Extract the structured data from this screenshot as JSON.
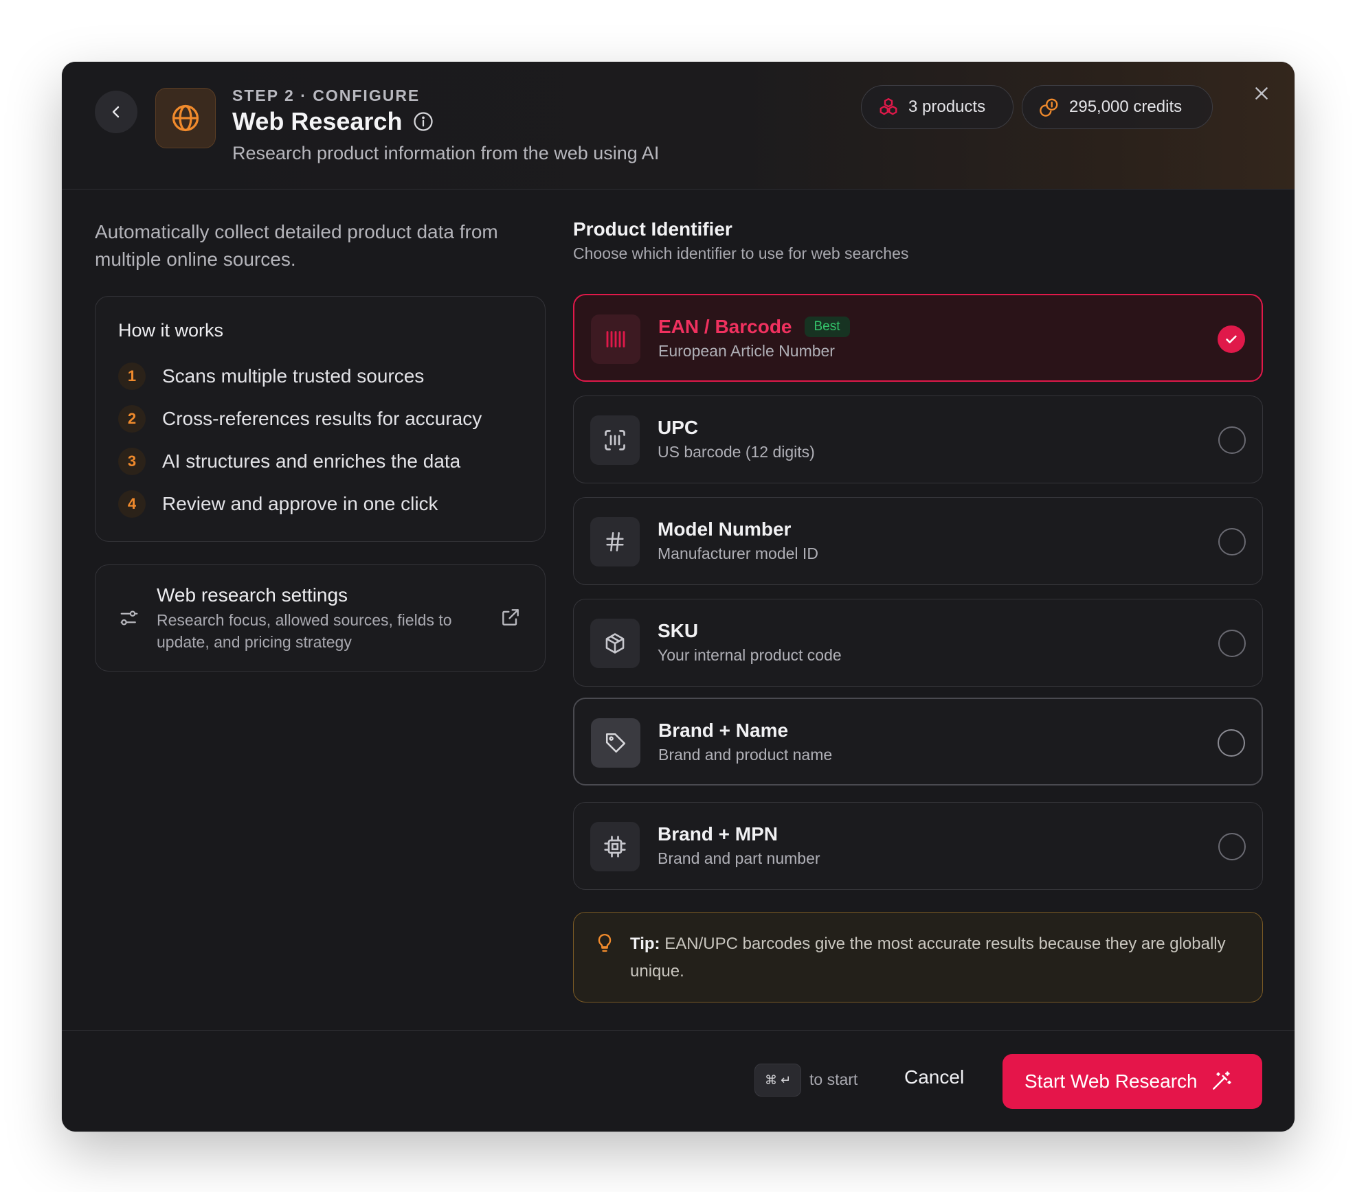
{
  "header": {
    "step": "STEP 2 · CONFIGURE",
    "title": "Web Research",
    "subtitle": "Research product information from the web using AI",
    "products_pill": "3 products",
    "credits_pill": "295,000 credits"
  },
  "left": {
    "intro": "Automatically collect detailed product data from multiple online sources.",
    "how_it_works": {
      "title": "How it works",
      "steps": [
        {
          "num": "1",
          "text": "Scans multiple trusted sources"
        },
        {
          "num": "2",
          "text": "Cross-references results for accuracy"
        },
        {
          "num": "3",
          "text": "AI structures and enriches the data"
        },
        {
          "num": "4",
          "text": "Review and approve in one click"
        }
      ]
    },
    "settings": {
      "title": "Web research settings",
      "description": "Research focus, allowed sources, fields to update, and pricing strategy"
    }
  },
  "identifier": {
    "title": "Product Identifier",
    "subtitle": "Choose which identifier to use for web searches",
    "options": [
      {
        "title": "EAN / Barcode",
        "badge": "Best",
        "subtitle": "European Article Number",
        "icon": "barcode-icon",
        "selected": true
      },
      {
        "title": "UPC",
        "subtitle": "US barcode (12 digits)",
        "icon": "scan-barcode-icon",
        "selected": false
      },
      {
        "title": "Model Number",
        "subtitle": "Manufacturer model ID",
        "icon": "hash-icon",
        "selected": false
      },
      {
        "title": "SKU",
        "subtitle": "Your internal product code",
        "icon": "package-icon",
        "selected": false
      },
      {
        "title": "Brand + Name",
        "subtitle": "Brand and product name",
        "icon": "tag-icon",
        "selected": false
      },
      {
        "title": "Brand + MPN",
        "subtitle": "Brand and part number",
        "icon": "chip-icon",
        "selected": false
      }
    ]
  },
  "tip": {
    "label": "Tip:",
    "text": "EAN/UPC barcodes give the most accurate results because they are globally unique."
  },
  "footer": {
    "shortcut": "⌘ ↵",
    "shortcut_hint": "to start",
    "cancel_label": "Cancel",
    "start_label": "Start Web Research"
  },
  "colors": {
    "accent": "#e5154a",
    "orange": "#f08a2c",
    "success": "#34c46b",
    "background": "#19191c"
  }
}
